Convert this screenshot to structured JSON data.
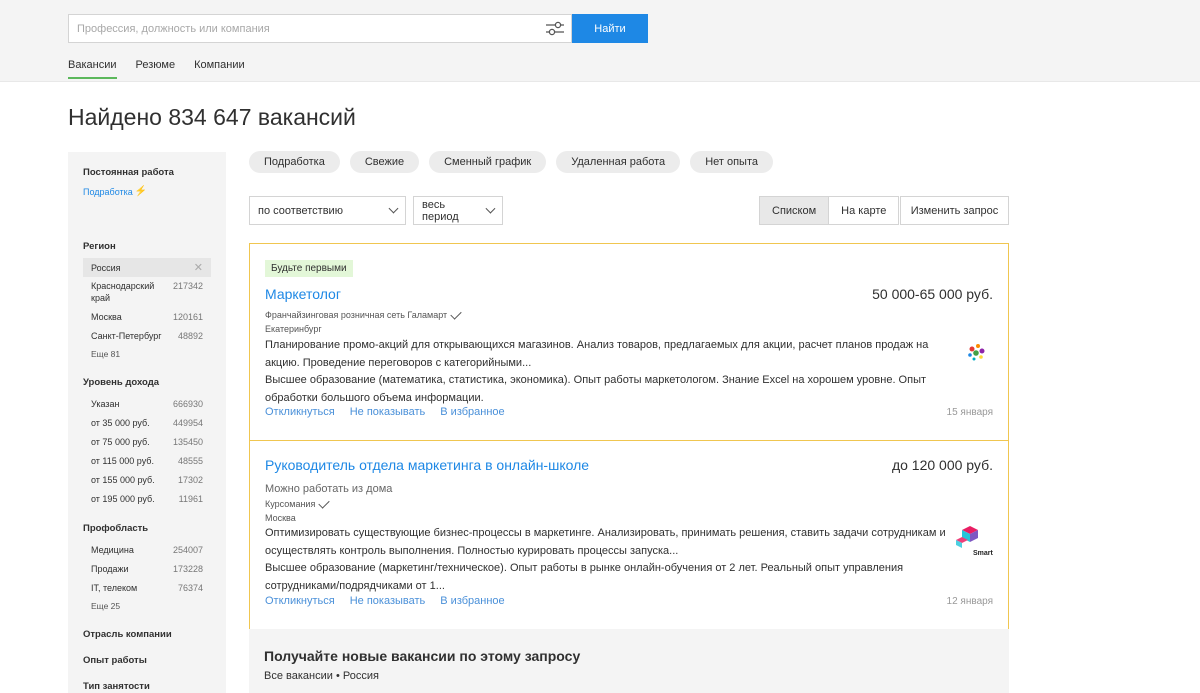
{
  "search": {
    "placeholder": "Профессия, должность или компания",
    "button": "Найти"
  },
  "nav": {
    "tabs": [
      "Вакансии",
      "Резюме",
      "Компании"
    ],
    "active": 0
  },
  "title": "Найдено 834 647 вакансий",
  "sidebar": {
    "employment_heading": "Постоянная работа",
    "parttime_link": "Подработка",
    "region": {
      "heading": "Регион",
      "items": [
        {
          "label": "Россия",
          "count": "",
          "selected": true
        },
        {
          "label": "Краснодарский край",
          "count": "217342"
        },
        {
          "label": "Москва",
          "count": "120161"
        },
        {
          "label": "Санкт-Петербург",
          "count": "48892"
        }
      ],
      "more": "Еще 81"
    },
    "income": {
      "heading": "Уровень дохода",
      "items": [
        {
          "label": "Указан",
          "count": "666930"
        },
        {
          "label": "от 35 000 руб.",
          "count": "449954"
        },
        {
          "label": "от 75 000 руб.",
          "count": "135450"
        },
        {
          "label": "от 115 000 руб.",
          "count": "48555"
        },
        {
          "label": "от 155 000 руб.",
          "count": "17302"
        },
        {
          "label": "от 195 000 руб.",
          "count": "11961"
        }
      ]
    },
    "field": {
      "heading": "Профобласть",
      "items": [
        {
          "label": "Медицина",
          "count": "254007"
        },
        {
          "label": "Продажи",
          "count": "173228"
        },
        {
          "label": "IT, телеком",
          "count": "76374"
        }
      ],
      "more": "Еще 25"
    },
    "industry_heading": "Отрасль компании",
    "experience_heading": "Опыт работы",
    "employment_type_heading": "Тип занятости"
  },
  "chips": [
    "Подработка",
    "Свежие",
    "Сменный график",
    "Удаленная работа",
    "Нет опыта"
  ],
  "sort": {
    "value": "по соответствию"
  },
  "period": {
    "value": "весь период"
  },
  "view": {
    "list": "Списком",
    "map": "На карте"
  },
  "change_query": "Изменить запрос",
  "vacancies": [
    {
      "badge": "Будьте первыми",
      "title": "Маркетолог",
      "salary": "50 000-65 000 руб.",
      "company": "Франчайзинговая розничная сеть Галамарт",
      "city": "Екатеринбург",
      "desc1": "Планирование промо-акций для открывающихся магазинов. Анализ товаров, предлагаемых для акции, расчет планов продаж на акцию. Проведение переговоров с категорийными...",
      "desc2": "Высшее образование (математика, статистика, экономика). Опыт работы маркетологом. Знание Excel на хорошем уровне. Опыт обработки большого объема информации.",
      "date": "15 января"
    },
    {
      "title": "Руководитель отдела маркетинга в онлайн-школе",
      "salary": "до 120 000 руб.",
      "remote": "Можно работать из дома",
      "company": "Курсомания",
      "city": "Москва",
      "desc1": "Оптимизировать существующие бизнес-процессы в маркетинге. Анализировать, принимать решения, ставить задачи сотрудникам и осуществлять контроль выполнения. Полностью курировать процессы запуска...",
      "desc2": "Высшее образование (маркетинг/техническое). Опыт работы в рынке онлайн-обучения от 2 лет. Реальный опыт управления сотрудниками/подрядчиками от 1...",
      "date": "12 января",
      "logo_text": "Smart"
    }
  ],
  "actions": {
    "respond": "Откликнуться",
    "hide": "Не показывать",
    "favorite": "В избранное"
  },
  "subscribe": {
    "title": "Получайте новые вакансии по этому запросу",
    "text": "Все вакансии • Россия"
  }
}
